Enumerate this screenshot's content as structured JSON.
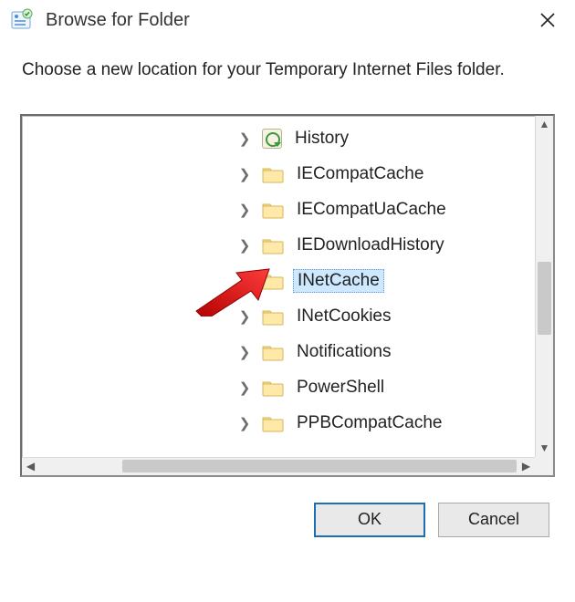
{
  "window": {
    "title": "Browse for Folder",
    "close_tooltip": "Close"
  },
  "instruction": "Choose a new location for your Temporary Internet Files folder.",
  "tree": {
    "items": [
      {
        "label": "History",
        "icon": "history-icon",
        "expandable": true,
        "selected": false
      },
      {
        "label": "IECompatCache",
        "icon": "folder-icon",
        "expandable": true,
        "selected": false
      },
      {
        "label": "IECompatUaCache",
        "icon": "folder-icon",
        "expandable": true,
        "selected": false
      },
      {
        "label": "IEDownloadHistory",
        "icon": "folder-icon",
        "expandable": true,
        "selected": false
      },
      {
        "label": "INetCache",
        "icon": "folder-icon",
        "expandable": true,
        "selected": true
      },
      {
        "label": "INetCookies",
        "icon": "folder-icon",
        "expandable": true,
        "selected": false
      },
      {
        "label": "Notifications",
        "icon": "folder-icon",
        "expandable": true,
        "selected": false
      },
      {
        "label": "PowerShell",
        "icon": "folder-icon",
        "expandable": true,
        "selected": false
      },
      {
        "label": "PPBCompatCache",
        "icon": "folder-icon",
        "expandable": true,
        "selected": false
      }
    ]
  },
  "buttons": {
    "ok": "OK",
    "cancel": "Cancel"
  },
  "annotation": {
    "arrow": "red-arrow"
  }
}
